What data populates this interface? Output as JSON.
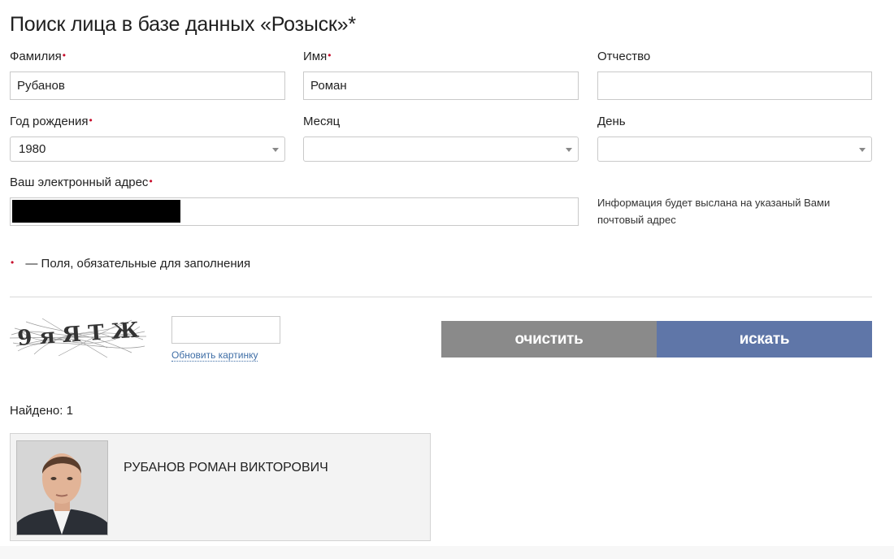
{
  "page": {
    "title": "Поиск лица в базе данных «Розыск»*"
  },
  "form": {
    "surname": {
      "label": "Фамилия",
      "value": "Рубанов",
      "required": "•"
    },
    "name": {
      "label": "Имя",
      "value": "Роман",
      "required": "•"
    },
    "patronymic": {
      "label": "Отчество",
      "value": ""
    },
    "birth_year": {
      "label": "Год рождения",
      "value": "1980",
      "required": "•"
    },
    "month": {
      "label": "Месяц",
      "value": ""
    },
    "day": {
      "label": "День",
      "value": ""
    },
    "email": {
      "label": "Ваш электронный адрес",
      "required": "•"
    },
    "email_hint": "Информация будет выслана на указаный Вами почтовый адрес",
    "required_note_marker": "•",
    "required_note": "— Поля, обязательные для заполнения"
  },
  "captcha": {
    "text": "9 я Я Т Ж",
    "input_value": "",
    "refresh_label": "Обновить картинку"
  },
  "buttons": {
    "clear": "очистить",
    "search": "искать"
  },
  "colors": {
    "clear_button": "#8a8a8a",
    "search_button": "#5f76a8",
    "required_mark": "#c8102e",
    "link": "#3f6ea6"
  },
  "results": {
    "found_label": "Найдено: 1",
    "items": [
      {
        "name": "РУБАНОВ РОМАН ВИКТОРОВИЧ",
        "photo": "portrait-photo"
      }
    ]
  }
}
